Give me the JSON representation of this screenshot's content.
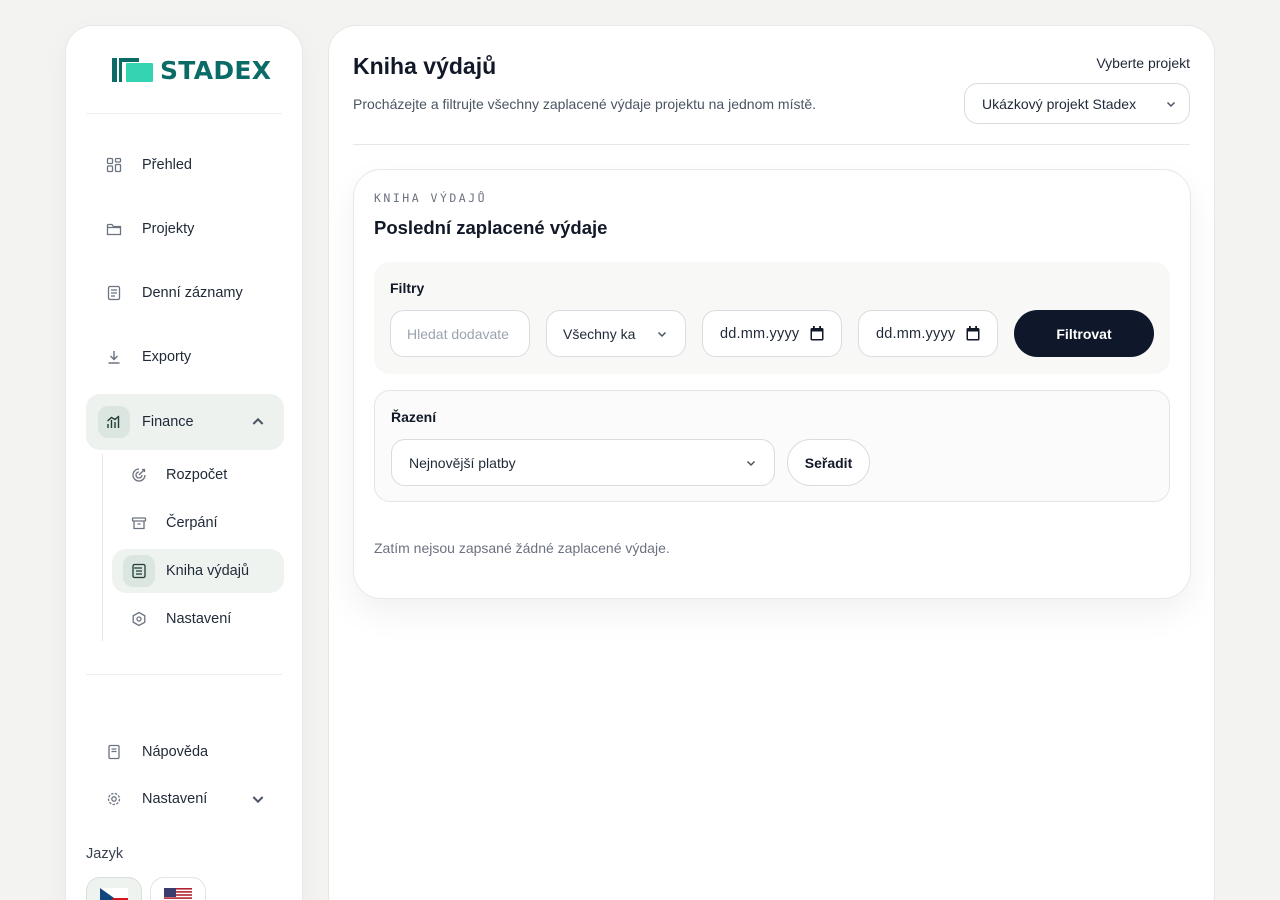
{
  "brand": {
    "name": "STADEX",
    "color": "#0b6b66",
    "accent": "#34d3b2"
  },
  "sidebar": {
    "items": [
      {
        "label": "Přehled",
        "icon": "grid-icon"
      },
      {
        "label": "Projekty",
        "icon": "folder-icon"
      },
      {
        "label": "Denní záznamy",
        "icon": "document-icon"
      },
      {
        "label": "Exporty",
        "icon": "download-icon"
      },
      {
        "label": "Finance",
        "icon": "chart-icon",
        "expanded": true
      }
    ],
    "finance_sub": [
      {
        "label": "Rozpočet",
        "icon": "target-icon"
      },
      {
        "label": "Čerpání",
        "icon": "wallet-icon"
      },
      {
        "label": "Kniha výdajů",
        "icon": "ledger-icon",
        "active": true
      },
      {
        "label": "Nastavení",
        "icon": "hexagon-icon"
      }
    ],
    "help": {
      "label": "Nápověda",
      "icon": "book-icon"
    },
    "settings": {
      "label": "Nastavení",
      "icon": "gear-icon"
    },
    "language_label": "Jazyk",
    "languages": [
      "czech-flag-icon",
      "us-flag-icon"
    ]
  },
  "header": {
    "title": "Kniha výdajů",
    "subtitle": "Procházejte a filtrujte všechny zaplacené výdaje projektu na jednom místě.",
    "project_label": "Vyberte projekt",
    "project_value": "Ukázkový projekt Stadex"
  },
  "card": {
    "eyebrow": "KNIHA VÝDAJŮ",
    "title": "Poslední zaplacené výdaje",
    "filters": {
      "label": "Filtry",
      "supplier_placeholder": "Hledat dodavate",
      "category_value": "Všechny ka",
      "date_from": "dd.mm.yyyy",
      "date_to": "dd.mm.yyyy",
      "button": "Filtrovat"
    },
    "sort": {
      "label": "Řazení",
      "value": "Nejnovější platby",
      "button": "Seřadit"
    },
    "empty_text": "Zatím nejsou zapsané žádné zaplacené výdaje."
  }
}
